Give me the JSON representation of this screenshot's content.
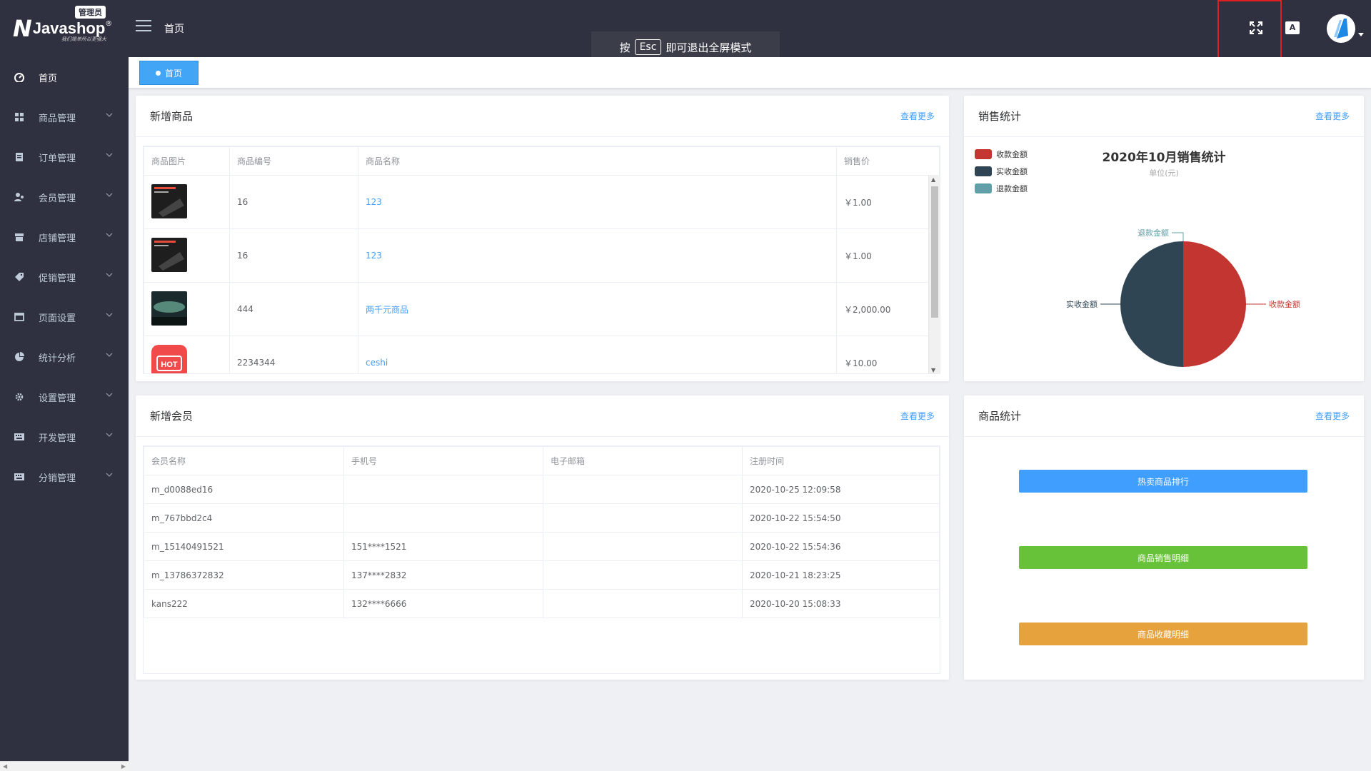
{
  "app": {
    "logo_mark": "N",
    "logo_name": "Javashop",
    "logo_reg": "®",
    "logo_badge": "管理员",
    "logo_slogan": "我们简单所以更强大"
  },
  "topbar": {
    "title": "首页",
    "lang_label": "A",
    "esc_prefix": "按",
    "esc_key": "Esc",
    "esc_suffix": "即可退出全屏模式"
  },
  "sidebar": {
    "items": [
      {
        "label": "首页",
        "icon": "dashboard-icon"
      },
      {
        "label": "商品管理",
        "icon": "grid-icon"
      },
      {
        "label": "订单管理",
        "icon": "order-icon"
      },
      {
        "label": "会员管理",
        "icon": "members-icon"
      },
      {
        "label": "店铺管理",
        "icon": "shop-icon"
      },
      {
        "label": "促销管理",
        "icon": "tag-icon"
      },
      {
        "label": "页面设置",
        "icon": "page-icon"
      },
      {
        "label": "统计分析",
        "icon": "pie-icon"
      },
      {
        "label": "设置管理",
        "icon": "gear-icon"
      },
      {
        "label": "开发管理",
        "icon": "dev-icon"
      },
      {
        "label": "分销管理",
        "icon": "distribution-icon"
      }
    ]
  },
  "tags": {
    "active": "首页"
  },
  "new_goods": {
    "title": "新增商品",
    "more": "查看更多",
    "columns": [
      "商品图片",
      "商品编号",
      "商品名称",
      "销售价"
    ],
    "rows": [
      {
        "sn": "16",
        "name": "123",
        "price": "￥1.00"
      },
      {
        "sn": "16",
        "name": "123",
        "price": "￥1.00"
      },
      {
        "sn": "444",
        "name": "两千元商品",
        "price": "￥2,000.00"
      },
      {
        "sn": "2234344",
        "name": "ceshi",
        "price": "￥10.00"
      }
    ],
    "hot_label": "HOT"
  },
  "sales_stats": {
    "title": "销售统计",
    "more": "查看更多"
  },
  "chart_data": {
    "type": "pie",
    "title": "2020年10月销售统计",
    "subtitle": "单位(元)",
    "legend_position": "top-left",
    "categories": [
      "收款金额",
      "实收金额",
      "退款金额"
    ],
    "values": [
      50,
      50,
      0
    ],
    "colors": [
      "#c23531",
      "#2f4554",
      "#61a0a8"
    ]
  },
  "new_members": {
    "title": "新增会员",
    "more": "查看更多",
    "columns": [
      "会员名称",
      "手机号",
      "电子邮箱",
      "注册时间"
    ],
    "rows": [
      {
        "name": "m_d0088ed16",
        "mobile": "",
        "email": "",
        "time": "2020-10-25 12:09:58"
      },
      {
        "name": "m_767bbd2c4",
        "mobile": "",
        "email": "",
        "time": "2020-10-22 15:54:50"
      },
      {
        "name": "m_15140491521",
        "mobile": "151****1521",
        "email": "",
        "time": "2020-10-22 15:54:36"
      },
      {
        "name": "m_13786372832",
        "mobile": "137****2832",
        "email": "",
        "time": "2020-10-21 18:23:25"
      },
      {
        "name": "kans222",
        "mobile": "132****6666",
        "email": "",
        "time": "2020-10-20 15:08:33"
      }
    ]
  },
  "goods_stats": {
    "title": "商品统计",
    "more": "查看更多",
    "buttons": [
      {
        "label": "热卖商品排行",
        "color": "#409eff"
      },
      {
        "label": "商品销售明细",
        "color": "#67c23a"
      },
      {
        "label": "商品收藏明细",
        "color": "#e6a23c"
      }
    ]
  }
}
